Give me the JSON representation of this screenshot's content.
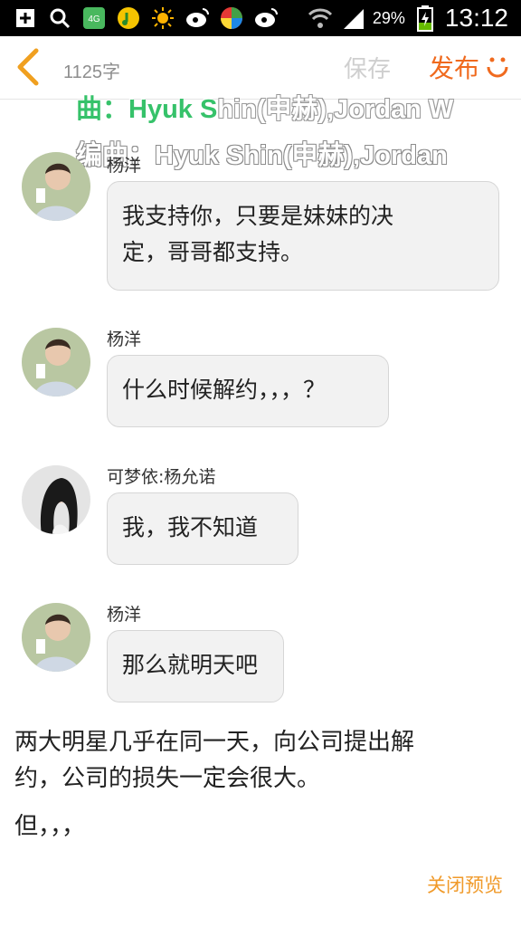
{
  "status_bar": {
    "battery_percent": "29%",
    "time": "13:12",
    "icons": [
      "add-icon",
      "search-icon",
      "app-4g-icon",
      "music-icon",
      "weather-sun-icon",
      "weibo-icon",
      "color-wheel-icon",
      "weibo-icon",
      "wifi-icon",
      "signal-icon",
      "battery-charging-icon"
    ]
  },
  "topbar": {
    "char_count": "1125字",
    "save_label": "保存",
    "publish_label": "发布",
    "accent": "#f06a1e"
  },
  "lyrics": {
    "line1_sung": "曲：Hyuk S",
    "line1_rest": "hin(申赫),Jordan W",
    "line2": "编曲：Hyuk Shin(申赫),Jordan"
  },
  "messages": [
    {
      "sender": "杨洋",
      "text_line1": "我支持你，只要是妹妹的决",
      "text_line2": "定，哥哥都支持。"
    },
    {
      "sender": "杨洋",
      "text": "什么时候解约，，，？"
    },
    {
      "sender": "可梦依:杨允诺",
      "text": "我，我不知道"
    },
    {
      "sender": "杨洋",
      "text": "那么就明天吧"
    }
  ],
  "body": {
    "paragraph1_line1": "两大明星几乎在同一天，向公司提出解",
    "paragraph1_line2": "约，公司的损失一定会很大。",
    "paragraph2": "但，，，"
  },
  "footer": {
    "close_preview_label": "关闭预览",
    "color": "#f09a2a"
  }
}
